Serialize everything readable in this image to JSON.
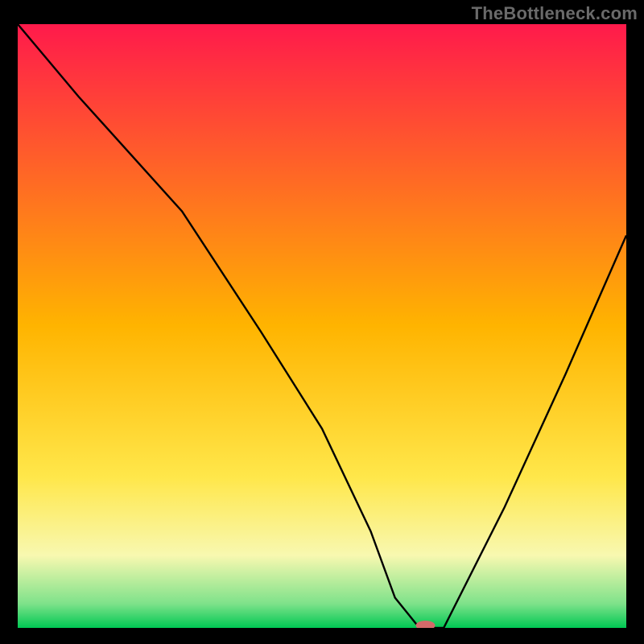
{
  "watermark": "TheBottleneck.com",
  "chart_data": {
    "type": "line",
    "title": "",
    "xlabel": "",
    "ylabel": "",
    "x_range": [
      0,
      100
    ],
    "y_range": [
      0,
      100
    ],
    "grid": false,
    "legend": false,
    "background_gradient": {
      "stops": [
        {
          "offset": 0.0,
          "color": "#ff1a4b"
        },
        {
          "offset": 0.5,
          "color": "#ffb400"
        },
        {
          "offset": 0.75,
          "color": "#ffe74a"
        },
        {
          "offset": 0.88,
          "color": "#f8f8b0"
        },
        {
          "offset": 0.96,
          "color": "#7ee28a"
        },
        {
          "offset": 1.0,
          "color": "#00c853"
        }
      ]
    },
    "series": [
      {
        "name": "bottleneck-curve",
        "color": "#000000",
        "x": [
          0,
          10,
          27,
          40,
          50,
          58,
          62,
          66,
          70,
          80,
          90,
          100
        ],
        "y": [
          100,
          88,
          69,
          49,
          33,
          16,
          5,
          0,
          0,
          20,
          42,
          65
        ]
      }
    ],
    "marker": {
      "name": "optimal-point",
      "x": 67,
      "y": 0,
      "color": "#d46a6a",
      "rx": 12,
      "ry": 6
    }
  }
}
